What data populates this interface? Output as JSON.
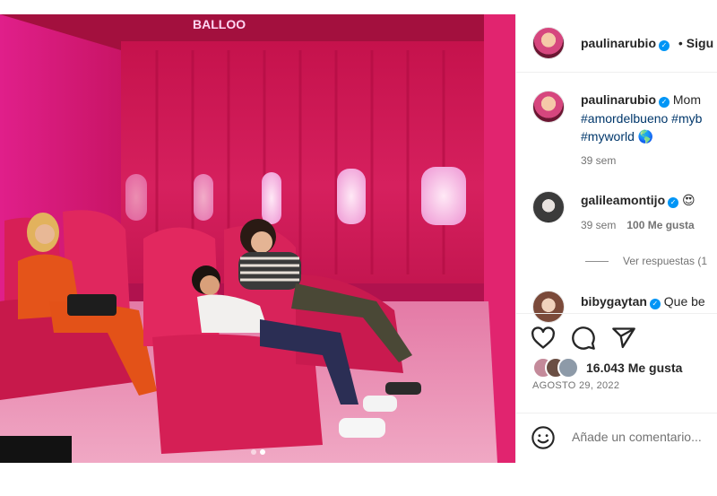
{
  "photo": {
    "sign_text": "BALLOO",
    "carousel": {
      "count": 2,
      "active": 2
    }
  },
  "header": {
    "username": "paulinarubio",
    "follow_label": "Sigu"
  },
  "caption": {
    "username": "paulinarubio",
    "text": "Mom",
    "hashtags_line1": "#amordelbueno #myb",
    "hashtags_line2": "#myworld",
    "emoji": "🌎",
    "age": "39 sem"
  },
  "comments": [
    {
      "username": "galileamontijo",
      "text": "😍",
      "age": "39 sem",
      "likes": "100 Me gusta",
      "replies_label": "Ver respuestas (1"
    },
    {
      "username": "bibygaytan",
      "text": "Que be"
    }
  ],
  "actions": {
    "likes_count_label": "16.043 Me gusta",
    "date": "AGOSTO 29, 2022"
  },
  "composer": {
    "placeholder": "Añade un comentario..."
  },
  "icons": [
    "verified-badge-icon",
    "heart-icon",
    "comment-icon",
    "share-icon",
    "emoji-icon"
  ],
  "colors": {
    "verified": "#0095f6",
    "hashtag": "#00376b",
    "photo_pink": "#d8246c"
  }
}
